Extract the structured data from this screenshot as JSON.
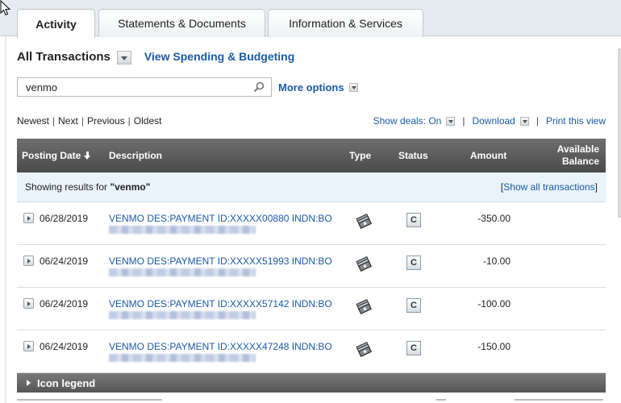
{
  "tabs": [
    {
      "label": "Activity",
      "active": true
    },
    {
      "label": "Statements & Documents",
      "active": false
    },
    {
      "label": "Information & Services",
      "active": false
    }
  ],
  "filter": {
    "selected": "All Transactions",
    "spending_link": "View Spending & Budgeting"
  },
  "search": {
    "value": "venmo",
    "more_options": "More options"
  },
  "pager": {
    "newest": "Newest",
    "next": "Next",
    "previous": "Previous",
    "oldest": "Oldest"
  },
  "tools": {
    "show_deals": "Show deals: On",
    "download": "Download",
    "print": "Print this view"
  },
  "table": {
    "headers": {
      "posting_date": "Posting Date",
      "description": "Description",
      "type": "Type",
      "status": "Status",
      "amount": "Amount",
      "balance_line1": "Available",
      "balance_line2": "Balance"
    },
    "results": {
      "prefix": "Showing results for ",
      "term": "\"venmo\"",
      "show_all": "Show all transactions"
    },
    "rows": [
      {
        "date": "06/28/2019",
        "description": "VENMO DES:PAYMENT ID:XXXXX00880 INDN:BO",
        "status": "C",
        "amount": "-350.00"
      },
      {
        "date": "06/24/2019",
        "description": "VENMO DES:PAYMENT ID:XXXXX51993 INDN:BO",
        "status": "C",
        "amount": "-10.00"
      },
      {
        "date": "06/24/2019",
        "description": "VENMO DES:PAYMENT ID:XXXXX57142 INDN:BO",
        "status": "C",
        "amount": "-100.00"
      },
      {
        "date": "06/24/2019",
        "description": "VENMO DES:PAYMENT ID:XXXXX47248 INDN:BO",
        "status": "C",
        "amount": "-150.00"
      }
    ]
  },
  "legend": {
    "label": "Icon legend"
  },
  "icons": {
    "search": "magnifier-icon",
    "type": "cash-payment-icon",
    "status": "cleared-status-icon"
  },
  "colors": {
    "link": "#1a5aa8",
    "header_bg": "#5c5c5c",
    "results_bg": "#e9f3fb"
  }
}
